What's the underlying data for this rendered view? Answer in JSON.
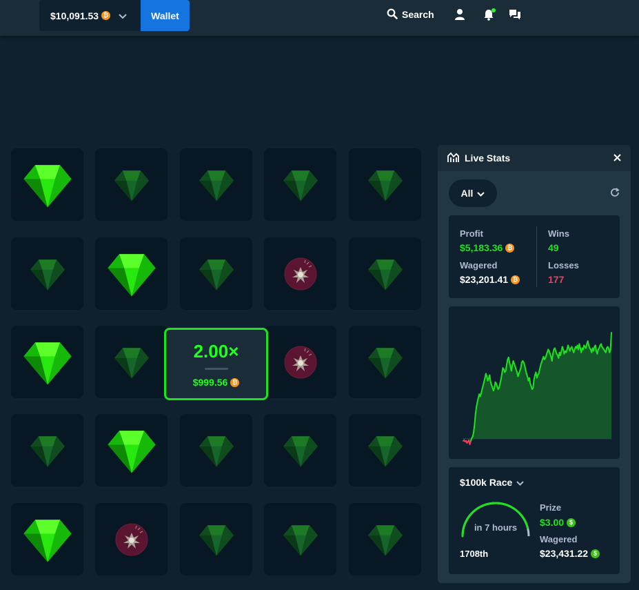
{
  "header": {
    "balance": "$10,091.53",
    "balance_currency_icon": "bitcoin-icon",
    "wallet_label": "Wallet",
    "search_label": "Search"
  },
  "game": {
    "tiles": [
      [
        "gem-revealed",
        "gem",
        "gem",
        "gem",
        "gem"
      ],
      [
        "gem",
        "gem-revealed",
        "gem",
        "mine",
        "gem"
      ],
      [
        "gem-revealed",
        "gem",
        "multiplier",
        "mine",
        "gem"
      ],
      [
        "gem",
        "gem-revealed",
        "gem",
        "gem",
        "gem"
      ],
      [
        "gem-revealed",
        "mine",
        "gem",
        "gem",
        "gem"
      ]
    ],
    "multiplier": "2.00×",
    "payout": "$999.56"
  },
  "live_stats": {
    "title": "Live Stats",
    "filter": "All",
    "profit_label": "Profit",
    "profit": "$5,183.36",
    "wagered_label": "Wagered",
    "wagered": "$23,201.41",
    "wins_label": "Wins",
    "wins": "49",
    "losses_label": "Losses",
    "losses": "177",
    "race": {
      "title": "$100k Race",
      "time_left": "in 7 hours",
      "progress_fraction": 0.92,
      "rank": "1708th",
      "prize_label": "Prize",
      "prize": "$3.00",
      "wagered_label": "Wagered",
      "wagered": "$23,431.22"
    }
  },
  "chart_data": {
    "type": "area",
    "series": [
      {
        "values": [
          -3,
          -2,
          -4,
          -3,
          -6,
          -4,
          -2,
          -8,
          -3,
          1,
          3,
          9,
          20,
          35,
          45,
          52,
          58,
          63,
          60,
          64,
          70,
          75,
          80,
          86,
          92,
          88,
          82,
          85,
          90,
          80,
          76,
          72,
          68,
          72,
          80,
          78,
          74,
          70,
          72,
          78,
          84,
          92,
          100,
          98,
          94,
          96,
          104,
          112,
          115,
          108,
          102,
          96,
          104,
          110,
          106,
          102,
          98,
          94,
          88,
          92,
          96,
          100,
          108,
          110,
          108,
          104,
          98,
          92,
          88,
          82,
          86,
          78,
          74,
          70,
          72,
          84,
          90,
          94,
          86,
          90,
          92,
          98,
          104,
          108,
          112,
          116,
          112,
          114,
          118,
          122,
          126,
          124,
          120,
          116,
          110,
          120,
          126,
          128,
          124,
          120,
          118,
          114,
          122,
          118,
          124,
          130,
          126,
          120,
          124,
          122,
          126,
          132,
          128,
          124,
          128,
          130,
          126,
          122,
          126,
          130,
          128,
          132,
          126,
          134,
          128,
          122,
          128,
          126,
          132,
          130,
          128,
          134,
          138,
          132,
          128,
          126,
          122,
          128,
          124,
          130,
          132,
          124,
          120,
          126,
          128,
          132,
          134,
          130,
          128,
          126,
          124,
          122,
          128,
          130,
          128,
          122,
          126,
          150
        ]
      }
    ],
    "colors": {
      "positive": "#1fe21f",
      "negative": "#ed4163",
      "fill": "#16562b"
    }
  }
}
